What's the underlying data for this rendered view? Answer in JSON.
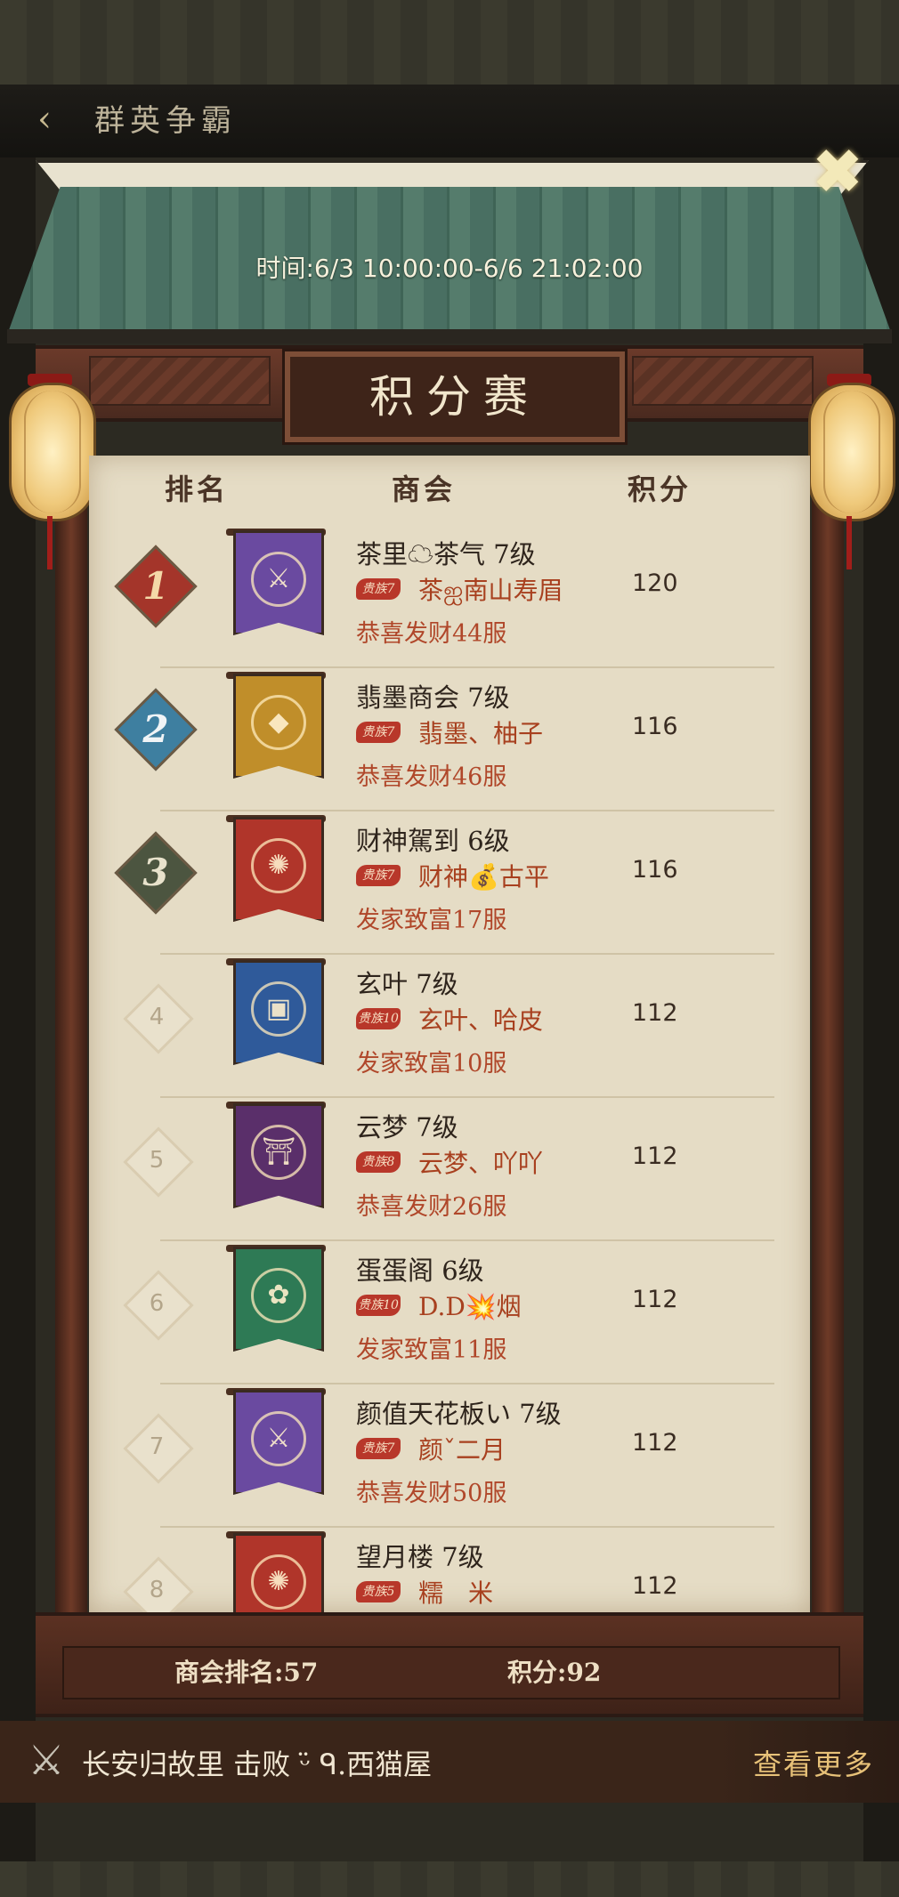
{
  "header": {
    "title": "群英争霸"
  },
  "event": {
    "time": "时间:6/3 10:00:00-6/6 21:02:00",
    "plaque": "积分赛"
  },
  "table": {
    "col_rank": "排名",
    "col_guild": "商会",
    "col_score": "积分"
  },
  "rows": [
    {
      "rank": "1",
      "name": "茶里☁茶气 7级",
      "tag": "贵族7",
      "leader": "茶ஐ南山寿眉",
      "server": "恭喜发财44服",
      "score": "120",
      "banner_color": "#6a4aa0",
      "emblem": "⚔"
    },
    {
      "rank": "2",
      "name": "翡墨商会 7级",
      "tag": "贵族7",
      "leader": "翡墨、柚子",
      "server": "恭喜发财46服",
      "score": "116",
      "banner_color": "#c08e2a",
      "emblem": "◆"
    },
    {
      "rank": "3",
      "name": "财神駕到 6级",
      "tag": "贵族7",
      "leader": "财神💰古平",
      "server": "发家致富17服",
      "score": "116",
      "banner_color": "#b0352a",
      "emblem": "✺"
    },
    {
      "rank": "4",
      "name": "玄叶 7级",
      "tag": "贵族10",
      "leader": "玄叶、哈皮",
      "server": "发家致富10服",
      "score": "112",
      "banner_color": "#2f5a9a",
      "emblem": "▣"
    },
    {
      "rank": "5",
      "name": "云梦 7级",
      "tag": "贵族8",
      "leader": "云梦、吖吖",
      "server": "恭喜发财26服",
      "score": "112",
      "banner_color": "#5a2f6a",
      "emblem": "⛩"
    },
    {
      "rank": "6",
      "name": "蛋蛋阁 6级",
      "tag": "贵族10",
      "leader": "D.D💥烟",
      "server": "发家致富11服",
      "score": "112",
      "banner_color": "#2e7a55",
      "emblem": "✿"
    },
    {
      "rank": "7",
      "name": "颜值天花板い 7级",
      "tag": "贵族7",
      "leader": "颜ˇ二月",
      "server": "恭喜发财50服",
      "score": "112",
      "banner_color": "#6a4aa0",
      "emblem": "⚔"
    },
    {
      "rank": "8",
      "name": "望月楼 7级",
      "tag": "贵族5",
      "leader": "糯　米",
      "server": "",
      "score": "112",
      "banner_color": "#b0352a",
      "emblem": "✺"
    }
  ],
  "footer": {
    "my_rank": "商会排名:57",
    "my_score": "积分:92"
  },
  "ticker": {
    "text": "长安归故里 击败 ᵕ̈ ᑫ.西猫屋",
    "more": "查看更多"
  }
}
